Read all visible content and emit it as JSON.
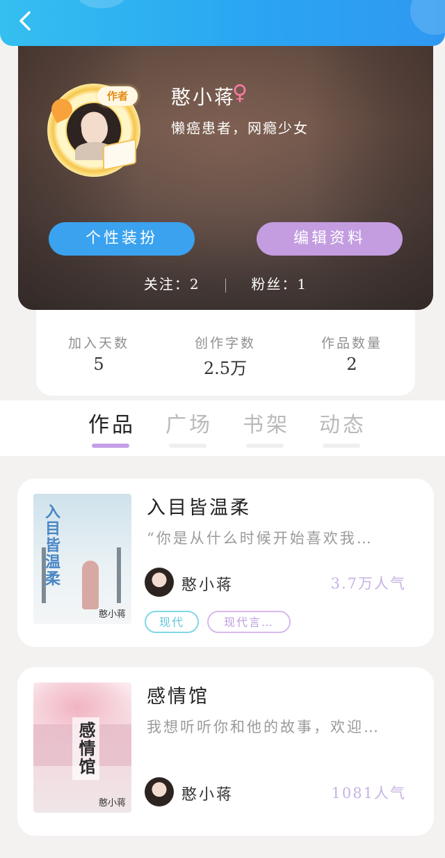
{
  "topbar": {
    "back_icon": "chevron-left-icon"
  },
  "profile": {
    "name": "憨小蒋",
    "gender_icon": "♀",
    "bio": "懒癌患者，网瘾少女",
    "author_tag": "作者",
    "dress_button": "个性装扮",
    "edit_button": "编辑资料",
    "follow_text": "关注：2",
    "fans_text": "粉丝：1"
  },
  "stats": [
    {
      "label": "加入天数",
      "value": "5"
    },
    {
      "label": "创作字数",
      "value": "2.5万"
    },
    {
      "label": "作品数量",
      "value": "2"
    }
  ],
  "tabs": [
    "作品",
    "广场",
    "书架",
    "动态"
  ],
  "books": [
    {
      "title": "入目皆温柔",
      "desc": "“你是从什么时候开始喜欢我…",
      "author": "憨小蒋",
      "popularity": "3.7万人气",
      "tags": [
        "现代",
        "现代言…"
      ],
      "cover_title": "入目皆温柔",
      "cover_author": "憨小蒋"
    },
    {
      "title": "感情馆",
      "desc": "我想听听你和他的故事，欢迎…",
      "author": "憨小蒋",
      "popularity": "1081人气",
      "cover_title": "感情馆",
      "cover_author": "憨小蒋"
    }
  ],
  "colors": {
    "accent_blue": "#3ba2ef",
    "accent_purple": "#c39de0",
    "tab_active_underline": "#c59fe6"
  }
}
